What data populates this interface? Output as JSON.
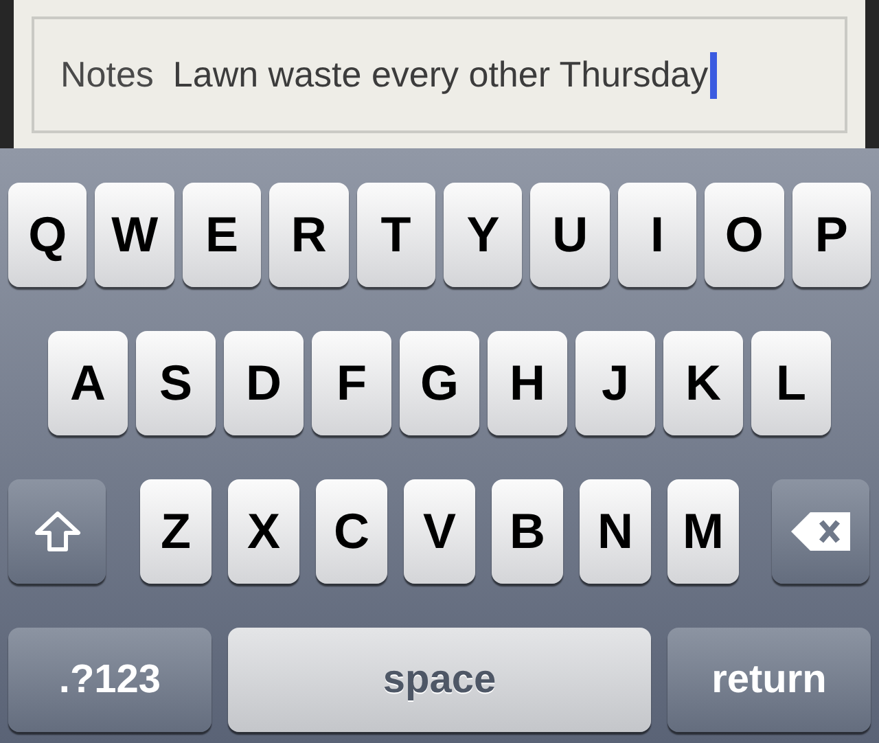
{
  "notes_field": {
    "label": "Notes",
    "value": "Lawn waste every other Thursday",
    "focused": true
  },
  "keyboard": {
    "rows": [
      {
        "keys": [
          {
            "kind": "letter",
            "label": "Q"
          },
          {
            "kind": "letter",
            "label": "W"
          },
          {
            "kind": "letter",
            "label": "E"
          },
          {
            "kind": "letter",
            "label": "R"
          },
          {
            "kind": "letter",
            "label": "T"
          },
          {
            "kind": "letter",
            "label": "Y"
          },
          {
            "kind": "letter",
            "label": "U"
          },
          {
            "kind": "letter",
            "label": "I"
          },
          {
            "kind": "letter",
            "label": "O"
          },
          {
            "kind": "letter",
            "label": "P"
          }
        ]
      },
      {
        "keys": [
          {
            "kind": "letter",
            "label": "A"
          },
          {
            "kind": "letter",
            "label": "S"
          },
          {
            "kind": "letter",
            "label": "D"
          },
          {
            "kind": "letter",
            "label": "F"
          },
          {
            "kind": "letter",
            "label": "G"
          },
          {
            "kind": "letter",
            "label": "H"
          },
          {
            "kind": "letter",
            "label": "J"
          },
          {
            "kind": "letter",
            "label": "K"
          },
          {
            "kind": "letter",
            "label": "L"
          }
        ]
      },
      {
        "keys": [
          {
            "kind": "shift"
          },
          {
            "kind": "letter",
            "label": "Z"
          },
          {
            "kind": "letter",
            "label": "X"
          },
          {
            "kind": "letter",
            "label": "C"
          },
          {
            "kind": "letter",
            "label": "V"
          },
          {
            "kind": "letter",
            "label": "B"
          },
          {
            "kind": "letter",
            "label": "N"
          },
          {
            "kind": "letter",
            "label": "M"
          },
          {
            "kind": "delete"
          }
        ]
      },
      {
        "keys": [
          {
            "kind": "mode",
            "label": ".?123"
          },
          {
            "kind": "space",
            "label": "space"
          },
          {
            "kind": "return",
            "label": "return"
          }
        ]
      }
    ]
  }
}
